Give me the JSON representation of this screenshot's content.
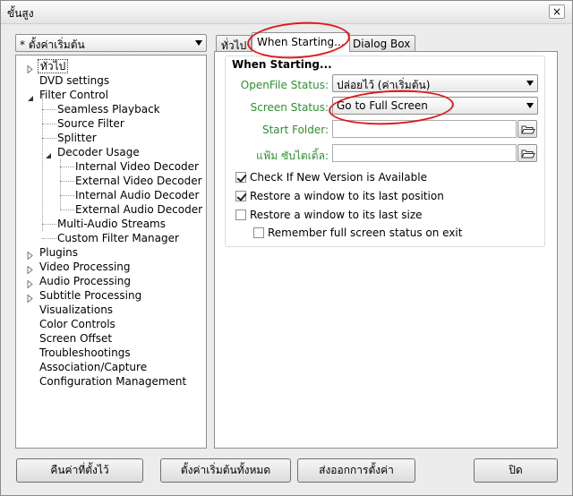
{
  "window": {
    "title": "ขั้นสูง",
    "close_glyph": "×"
  },
  "preset": {
    "value": "* ตั้งค่าเริ่มต้น"
  },
  "tree": {
    "items": [
      {
        "label": "ทั่วไป"
      },
      {
        "label": "DVD settings"
      },
      {
        "label": "Filter Control"
      },
      {
        "label": "Seamless Playback"
      },
      {
        "label": "Source Filter"
      },
      {
        "label": "Splitter"
      },
      {
        "label": "Decoder Usage"
      },
      {
        "label": "Internal Video Decoder"
      },
      {
        "label": "External Video Decoder"
      },
      {
        "label": "Internal Audio Decoder"
      },
      {
        "label": "External Audio Decoder"
      },
      {
        "label": "Multi-Audio Streams"
      },
      {
        "label": "Custom Filter Manager"
      },
      {
        "label": "Plugins"
      },
      {
        "label": "Video Processing"
      },
      {
        "label": "Audio Processing"
      },
      {
        "label": "Subtitle Processing"
      },
      {
        "label": "Visualizations"
      },
      {
        "label": "Color Controls"
      },
      {
        "label": "Screen Offset"
      },
      {
        "label": "Troubleshootings"
      },
      {
        "label": "Association/Capture"
      },
      {
        "label": "Configuration Management"
      }
    ]
  },
  "tabs": [
    {
      "label": "ทั่วไป"
    },
    {
      "label": "When Starting..."
    },
    {
      "label": "Dialog Box"
    }
  ],
  "when_starting": {
    "group_title": "When Starting...",
    "openfile_label": "OpenFile Status:",
    "openfile_value": "ปล่อยไว้ (ค่าเริ่มต้น)",
    "screen_label": "Screen Status:",
    "screen_value": "Go to Full Screen",
    "start_folder_label": "Start Folder:",
    "start_folder_value": "",
    "playlist_label": "แฟ้ม ซับไตเติ้ล:",
    "playlist_value": "",
    "check_version": {
      "label": "Check If New Version is Available",
      "checked": true
    },
    "restore_position": {
      "label": "Restore a window to its last position",
      "checked": true
    },
    "restore_size": {
      "label": "Restore a window to its last size",
      "checked": false
    },
    "remember_fullscreen": {
      "label": "Remember full screen status on exit",
      "checked": false
    }
  },
  "buttons": {
    "reset": "คืนค่าที่ตั้งไว้",
    "reset_all": "ตั้งค่าเริ่มต้นทั้งหมด",
    "export": "ส่งออกการตั้งค่า",
    "close": "ปิด"
  },
  "colors": {
    "annotation": "#e0191b",
    "field_label": "#2f8f2f"
  }
}
